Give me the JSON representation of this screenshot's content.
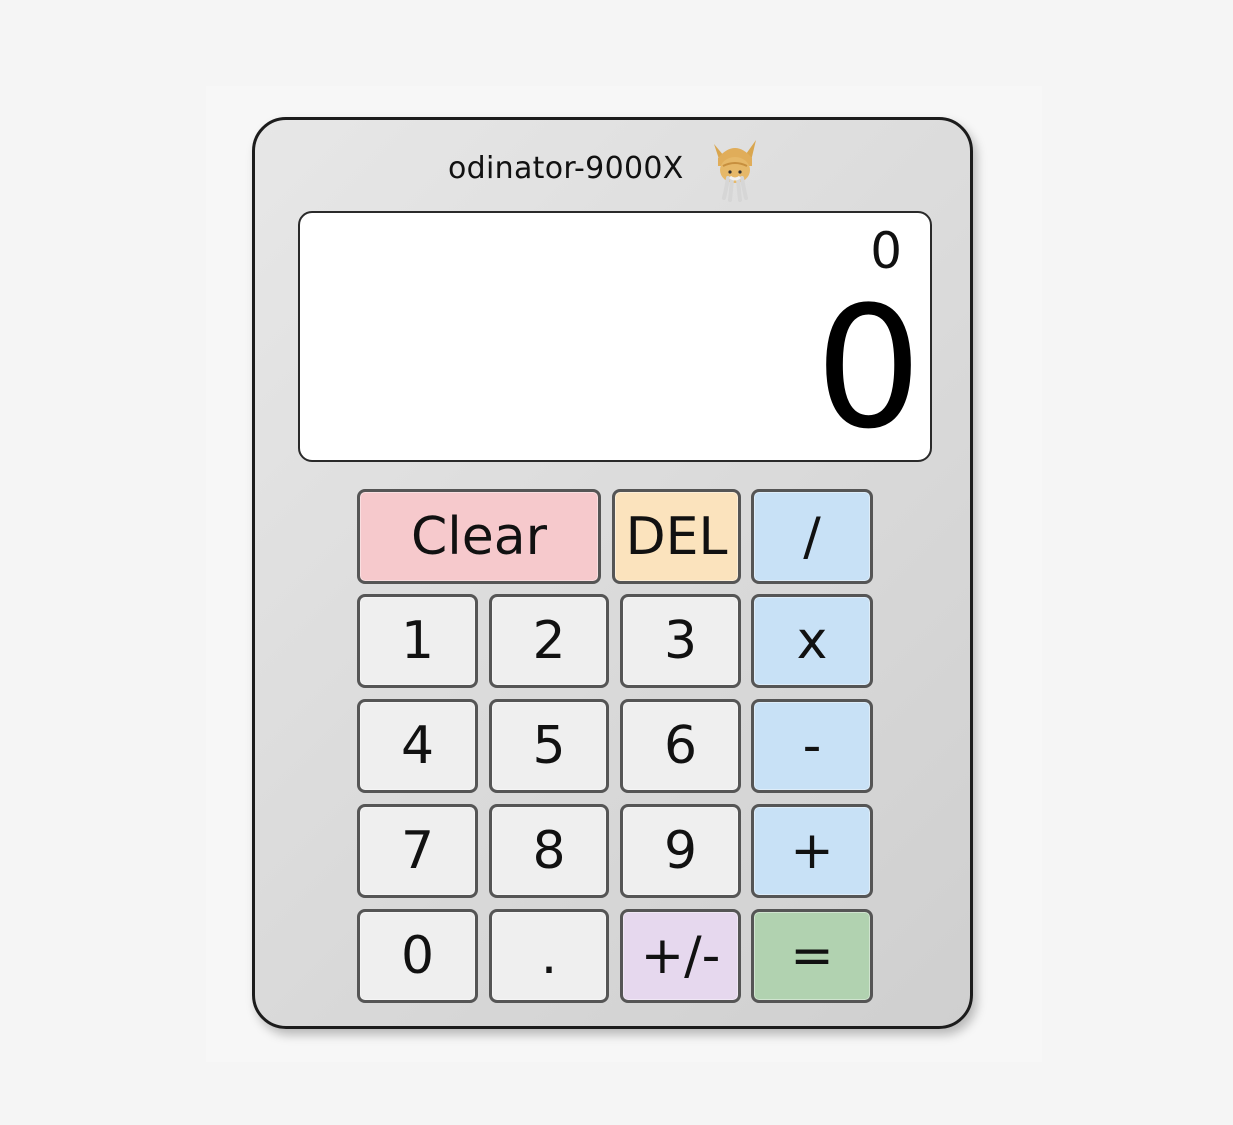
{
  "app": {
    "brand_title": "odinator-9000X",
    "logo_icon": "viking-cat-icon"
  },
  "display": {
    "previous_value": "0",
    "current_value": "0"
  },
  "keys": {
    "clear": "Clear",
    "del": "DEL",
    "divide": "/",
    "one": "1",
    "two": "2",
    "three": "3",
    "multiply": "x",
    "four": "4",
    "five": "5",
    "six": "6",
    "subtract": "-",
    "seven": "7",
    "eight": "8",
    "nine": "9",
    "add": "+",
    "zero": "0",
    "decimal": ".",
    "negate": "+/-",
    "equals": "="
  },
  "colors": {
    "clear": "#f6c9cc",
    "del": "#fbe3bd",
    "operator": "#c8e1f6",
    "digit": "#efefef",
    "negate": "#e6d8ee",
    "equals": "#b1d2b0"
  }
}
